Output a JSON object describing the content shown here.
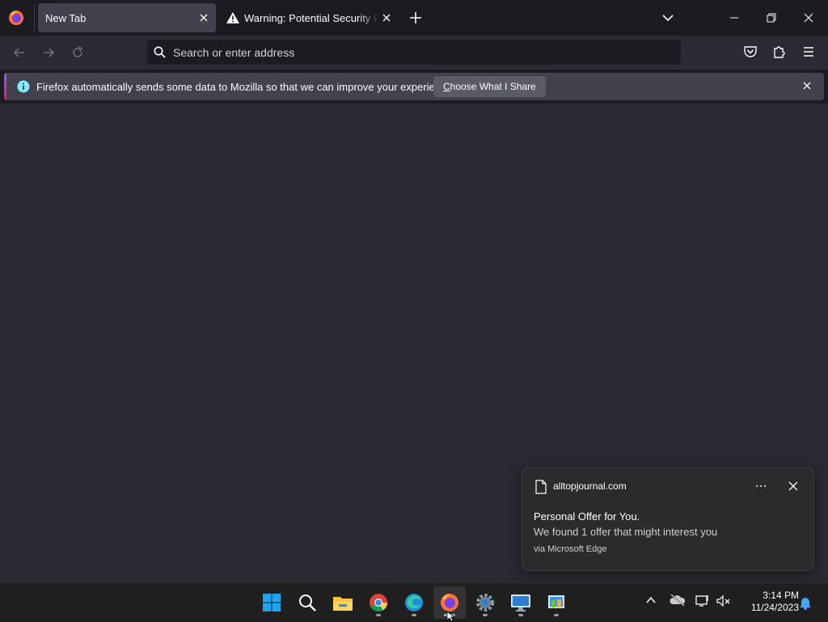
{
  "browser": {
    "tabs": [
      {
        "title": "New Tab",
        "active": true
      },
      {
        "title": "Warning: Potential Security Risk Ahead",
        "active": false
      }
    ],
    "urlbar": {
      "placeholder": "Search or enter address",
      "value": ""
    },
    "notification_bar": {
      "message": "Firefox automatically sends some data to Mozilla so that we can improve your experience.",
      "button_prefix": "C",
      "button_rest": "hoose What I Share"
    }
  },
  "toast": {
    "site": "alltopjournal.com",
    "title": "Personal Offer for You.",
    "body": "We found 1 offer that might interest you",
    "via": "via Microsoft Edge"
  },
  "taskbar": {
    "apps": [
      "start-icon",
      "search-icon",
      "file-explorer-icon",
      "chrome-icon",
      "edge-icon",
      "firefox-icon",
      "settings-icon",
      "remote-desktop-icon",
      "control-panel-icon"
    ],
    "active_app": "firefox-icon",
    "time": "3:14 PM",
    "date": "11/24/2023"
  },
  "colors": {
    "accent_top": "#9059ff",
    "accent_bottom": "#e31587",
    "toolbar": "#2b2a33",
    "tab_active": "#42414d"
  }
}
